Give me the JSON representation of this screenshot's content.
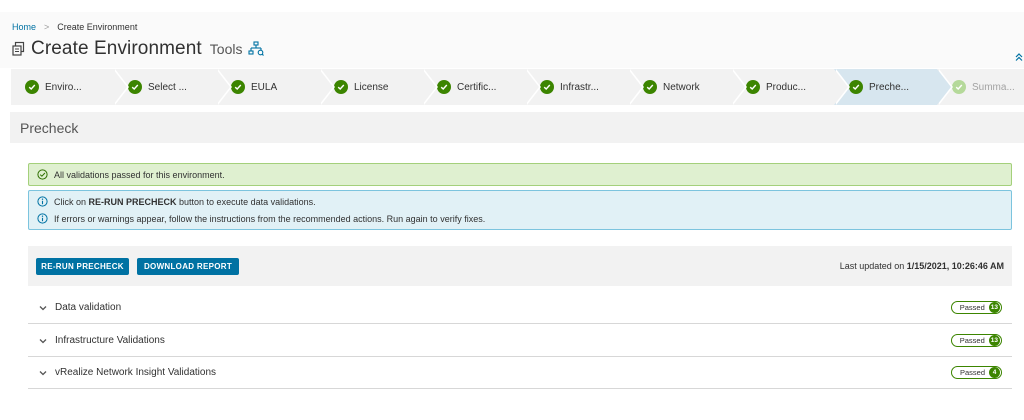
{
  "breadcrumb": {
    "home": "Home",
    "current": "Create Environment"
  },
  "header": {
    "title": "Create Environment",
    "tools_label": "Tools"
  },
  "steps": [
    {
      "label": "Enviro...",
      "state": "done"
    },
    {
      "label": "Select ...",
      "state": "done"
    },
    {
      "label": "EULA",
      "state": "done"
    },
    {
      "label": "License",
      "state": "done"
    },
    {
      "label": "Certific...",
      "state": "done"
    },
    {
      "label": "Infrastr...",
      "state": "done"
    },
    {
      "label": "Network",
      "state": "done"
    },
    {
      "label": "Produc...",
      "state": "done"
    },
    {
      "label": "Preche...",
      "state": "active"
    },
    {
      "label": "Summa...",
      "state": "pending"
    }
  ],
  "section": {
    "title": "Precheck"
  },
  "alerts": {
    "success": "All validations passed for this environment.",
    "info_line1_prefix": "Click on ",
    "info_line1_bold": "RE-RUN PRECHECK",
    "info_line1_suffix": " button to execute data validations.",
    "info_line2": "If errors or warnings appear, follow the instructions from the recommended actions. Run again to verify fixes."
  },
  "toolbar": {
    "rerun_label": "RE-RUN PRECHECK",
    "download_label": "DOWNLOAD REPORT",
    "last_updated_label": "Last updated on ",
    "last_updated_value": "1/15/2021, 10:26:46 AM"
  },
  "validations": [
    {
      "title": "Data validation",
      "status": "Passed",
      "count": "13"
    },
    {
      "title": "Infrastructure Validations",
      "status": "Passed",
      "count": "13"
    },
    {
      "title": "vRealize Network Insight Validations",
      "status": "Passed",
      "count": "4"
    }
  ],
  "colors": {
    "primary": "#0072a3",
    "success": "#3c8500",
    "active_step": "#d7e6ef",
    "success_alert_bg": "#dff0d0",
    "info_alert_bg": "#e1f1f6"
  },
  "icons": {
    "page": "environment-icon",
    "tools": "network-tree-icon",
    "collapse": "double-chevron-up-icon",
    "step_done": "check-circle-icon",
    "success_alert": "check-circle-outline-icon",
    "info_alert": "info-circle-icon",
    "accordion": "chevron-down-icon"
  }
}
